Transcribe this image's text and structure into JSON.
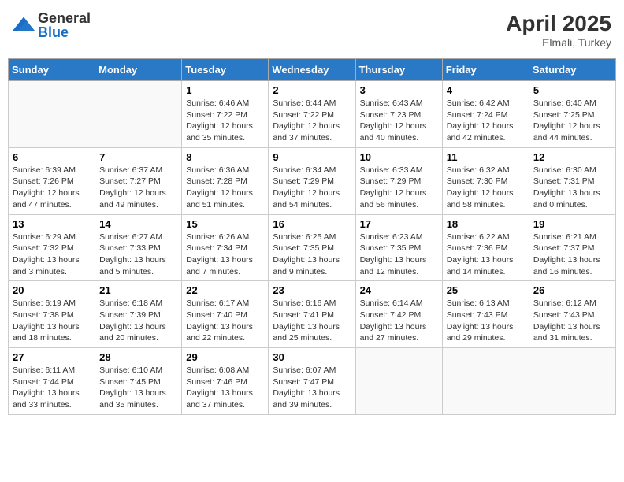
{
  "header": {
    "logo_general": "General",
    "logo_blue": "Blue",
    "month_title": "April 2025",
    "location": "Elmali, Turkey"
  },
  "days_of_week": [
    "Sunday",
    "Monday",
    "Tuesday",
    "Wednesday",
    "Thursday",
    "Friday",
    "Saturday"
  ],
  "weeks": [
    [
      {
        "num": "",
        "info": ""
      },
      {
        "num": "",
        "info": ""
      },
      {
        "num": "1",
        "info": "Sunrise: 6:46 AM\nSunset: 7:22 PM\nDaylight: 12 hours and 35 minutes."
      },
      {
        "num": "2",
        "info": "Sunrise: 6:44 AM\nSunset: 7:22 PM\nDaylight: 12 hours and 37 minutes."
      },
      {
        "num": "3",
        "info": "Sunrise: 6:43 AM\nSunset: 7:23 PM\nDaylight: 12 hours and 40 minutes."
      },
      {
        "num": "4",
        "info": "Sunrise: 6:42 AM\nSunset: 7:24 PM\nDaylight: 12 hours and 42 minutes."
      },
      {
        "num": "5",
        "info": "Sunrise: 6:40 AM\nSunset: 7:25 PM\nDaylight: 12 hours and 44 minutes."
      }
    ],
    [
      {
        "num": "6",
        "info": "Sunrise: 6:39 AM\nSunset: 7:26 PM\nDaylight: 12 hours and 47 minutes."
      },
      {
        "num": "7",
        "info": "Sunrise: 6:37 AM\nSunset: 7:27 PM\nDaylight: 12 hours and 49 minutes."
      },
      {
        "num": "8",
        "info": "Sunrise: 6:36 AM\nSunset: 7:28 PM\nDaylight: 12 hours and 51 minutes."
      },
      {
        "num": "9",
        "info": "Sunrise: 6:34 AM\nSunset: 7:29 PM\nDaylight: 12 hours and 54 minutes."
      },
      {
        "num": "10",
        "info": "Sunrise: 6:33 AM\nSunset: 7:29 PM\nDaylight: 12 hours and 56 minutes."
      },
      {
        "num": "11",
        "info": "Sunrise: 6:32 AM\nSunset: 7:30 PM\nDaylight: 12 hours and 58 minutes."
      },
      {
        "num": "12",
        "info": "Sunrise: 6:30 AM\nSunset: 7:31 PM\nDaylight: 13 hours and 0 minutes."
      }
    ],
    [
      {
        "num": "13",
        "info": "Sunrise: 6:29 AM\nSunset: 7:32 PM\nDaylight: 13 hours and 3 minutes."
      },
      {
        "num": "14",
        "info": "Sunrise: 6:27 AM\nSunset: 7:33 PM\nDaylight: 13 hours and 5 minutes."
      },
      {
        "num": "15",
        "info": "Sunrise: 6:26 AM\nSunset: 7:34 PM\nDaylight: 13 hours and 7 minutes."
      },
      {
        "num": "16",
        "info": "Sunrise: 6:25 AM\nSunset: 7:35 PM\nDaylight: 13 hours and 9 minutes."
      },
      {
        "num": "17",
        "info": "Sunrise: 6:23 AM\nSunset: 7:35 PM\nDaylight: 13 hours and 12 minutes."
      },
      {
        "num": "18",
        "info": "Sunrise: 6:22 AM\nSunset: 7:36 PM\nDaylight: 13 hours and 14 minutes."
      },
      {
        "num": "19",
        "info": "Sunrise: 6:21 AM\nSunset: 7:37 PM\nDaylight: 13 hours and 16 minutes."
      }
    ],
    [
      {
        "num": "20",
        "info": "Sunrise: 6:19 AM\nSunset: 7:38 PM\nDaylight: 13 hours and 18 minutes."
      },
      {
        "num": "21",
        "info": "Sunrise: 6:18 AM\nSunset: 7:39 PM\nDaylight: 13 hours and 20 minutes."
      },
      {
        "num": "22",
        "info": "Sunrise: 6:17 AM\nSunset: 7:40 PM\nDaylight: 13 hours and 22 minutes."
      },
      {
        "num": "23",
        "info": "Sunrise: 6:16 AM\nSunset: 7:41 PM\nDaylight: 13 hours and 25 minutes."
      },
      {
        "num": "24",
        "info": "Sunrise: 6:14 AM\nSunset: 7:42 PM\nDaylight: 13 hours and 27 minutes."
      },
      {
        "num": "25",
        "info": "Sunrise: 6:13 AM\nSunset: 7:43 PM\nDaylight: 13 hours and 29 minutes."
      },
      {
        "num": "26",
        "info": "Sunrise: 6:12 AM\nSunset: 7:43 PM\nDaylight: 13 hours and 31 minutes."
      }
    ],
    [
      {
        "num": "27",
        "info": "Sunrise: 6:11 AM\nSunset: 7:44 PM\nDaylight: 13 hours and 33 minutes."
      },
      {
        "num": "28",
        "info": "Sunrise: 6:10 AM\nSunset: 7:45 PM\nDaylight: 13 hours and 35 minutes."
      },
      {
        "num": "29",
        "info": "Sunrise: 6:08 AM\nSunset: 7:46 PM\nDaylight: 13 hours and 37 minutes."
      },
      {
        "num": "30",
        "info": "Sunrise: 6:07 AM\nSunset: 7:47 PM\nDaylight: 13 hours and 39 minutes."
      },
      {
        "num": "",
        "info": ""
      },
      {
        "num": "",
        "info": ""
      },
      {
        "num": "",
        "info": ""
      }
    ]
  ]
}
